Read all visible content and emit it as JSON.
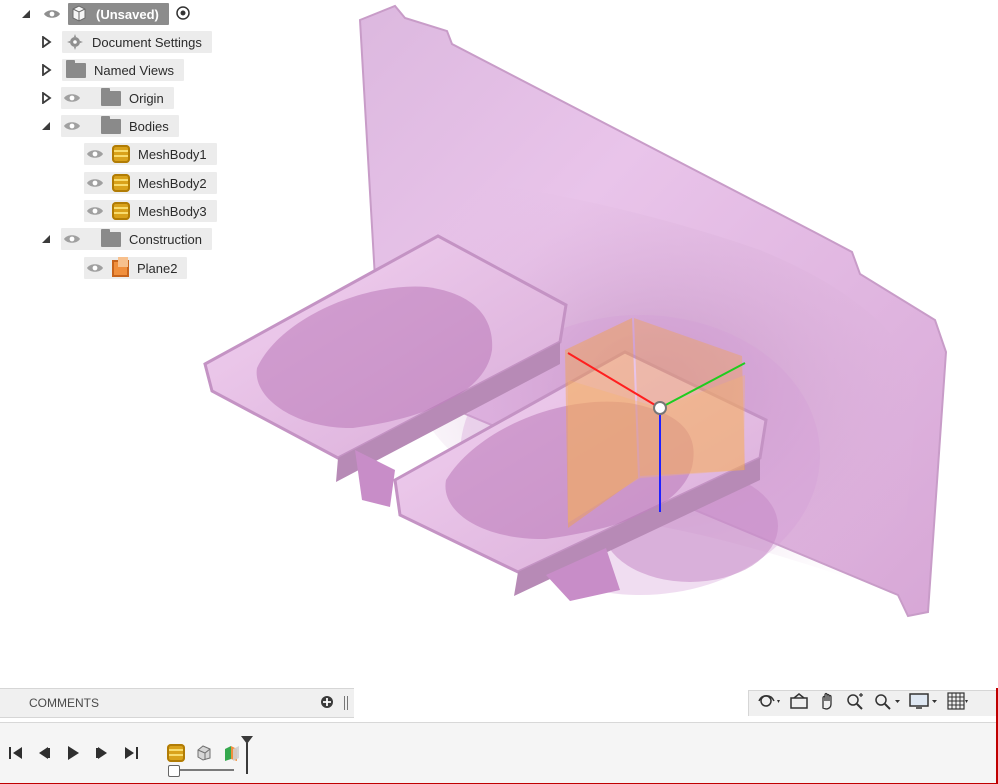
{
  "browser": {
    "root": {
      "label": "(Unsaved)"
    },
    "items": [
      {
        "label": "Document Settings"
      },
      {
        "label": "Named Views"
      },
      {
        "label": "Origin"
      },
      {
        "label": "Bodies"
      },
      {
        "label": "MeshBody1"
      },
      {
        "label": "MeshBody2"
      },
      {
        "label": "MeshBody3"
      },
      {
        "label": "Construction"
      },
      {
        "label": "Plane2"
      }
    ]
  },
  "comments": {
    "label": "COMMENTS"
  },
  "icons": {
    "nav": [
      "orbit-icon",
      "look-at-icon",
      "pan-icon",
      "zoom-icon",
      "fit-icon",
      "display-settings-icon",
      "grid-icon"
    ],
    "timeline": [
      "start-icon",
      "previous-icon",
      "play-icon",
      "next-icon",
      "end-icon",
      "mesh-feature-icon",
      "body-feature-icon",
      "plane-feature-icon",
      "marker-icon"
    ]
  },
  "colors": {
    "model": "#e6b3e6",
    "x_axis": "#ff1f1f",
    "y_axis": "#1fcc1f",
    "z_axis": "#2020ff",
    "gizmo": "#f5a33a",
    "frame_border": "#c00000"
  }
}
